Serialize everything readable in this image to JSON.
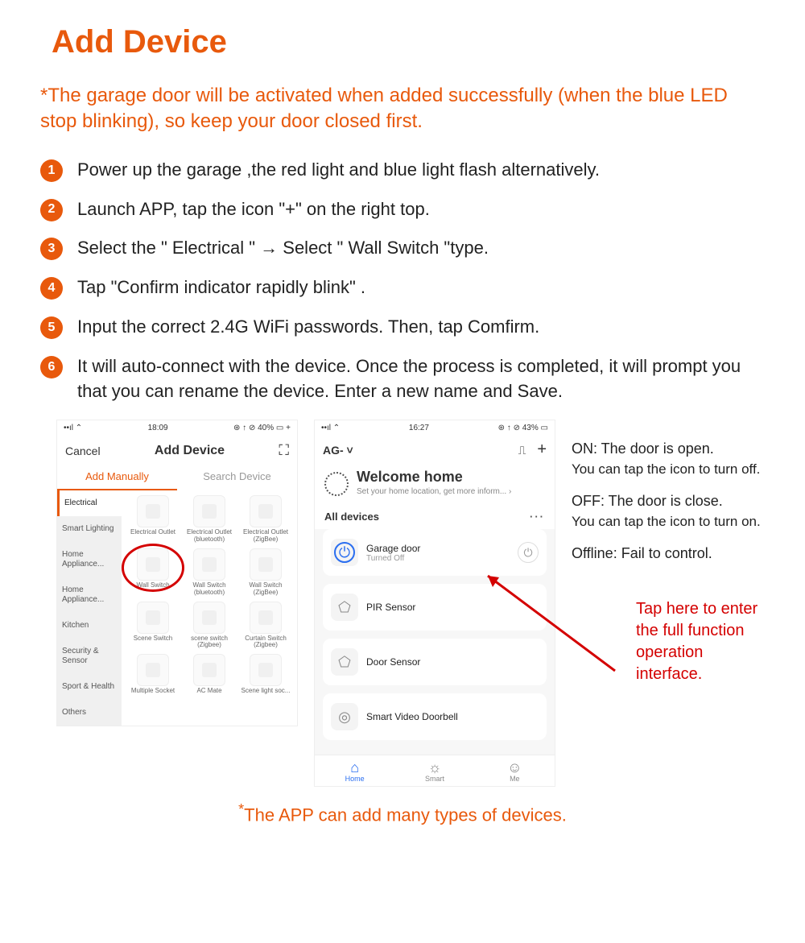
{
  "title": "Add Device",
  "warning": "*The garage door will be activated when added successfully (when the blue LED stop blinking), so keep your door closed first.",
  "steps": [
    "Power up the garage ,the red light and blue light flash alternatively.",
    "Launch APP, tap the icon  \"+\"  on the right top.",
    "Select the \" Electrical \"    →  Select \" Wall Switch  \"type.",
    "Tap  \"Confirm indicator rapidly blink\"  .",
    "Input the correct 2.4G WiFi passwords. Then, tap Comfirm.",
    "It will auto-connect with the device. Once the process is completed, it will prompt you that you can rename the device. Enter a new name and Save."
  ],
  "phone1": {
    "time": "18:09",
    "battery": "40%",
    "cancel": "Cancel",
    "title": "Add Device",
    "tab_manual": "Add Manually",
    "tab_search": "Search Device",
    "categories": [
      "Electrical",
      "Smart Lighting",
      "Home Appliance...",
      "Home Appliance...",
      "Kitchen",
      "Security & Sensor",
      "Sport & Health",
      "Others"
    ],
    "cells": [
      "Electrical Outlet",
      "Electrical Outlet (bluetooth)",
      "Electrical Outlet (ZigBee)",
      "Wall Switch",
      "Wall Switch (bluetooth)",
      "Wall Switch (ZigBee)",
      "Scene Switch",
      "scene switch (Zigbee)",
      "Curtain Switch (Zigbee)",
      "Multiple Socket",
      "AC Mate",
      "Scene light soc..."
    ]
  },
  "phone2": {
    "time": "16:27",
    "battery": "43%",
    "location": "AG- ˅",
    "welcome_title": "Welcome home",
    "welcome_sub": "Set your home location, get more inform...  ›",
    "all_devices": "All devices",
    "devices": [
      {
        "name": "Garage door",
        "status": "Turned Off",
        "power": true,
        "icon": "power"
      },
      {
        "name": "PIR Sensor",
        "status": "",
        "power": false,
        "icon": "home"
      },
      {
        "name": "Door Sensor",
        "status": "",
        "power": false,
        "icon": "home"
      },
      {
        "name": "Smart Video Doorbell",
        "status": "",
        "power": false,
        "icon": "cam"
      }
    ],
    "nav": {
      "home": "Home",
      "smart": "Smart",
      "me": "Me"
    }
  },
  "notes": {
    "on_label": "ON: The door is open.",
    "on_sub": "You can tap the icon to turn off.",
    "off_label": "OFF: The door is close.",
    "off_sub": "You can tap the icon to turn on.",
    "offline": "Offline: Fail to control.",
    "tap": "Tap here to enter the full function operation interface."
  },
  "footer": "The APP can add many types of devices."
}
